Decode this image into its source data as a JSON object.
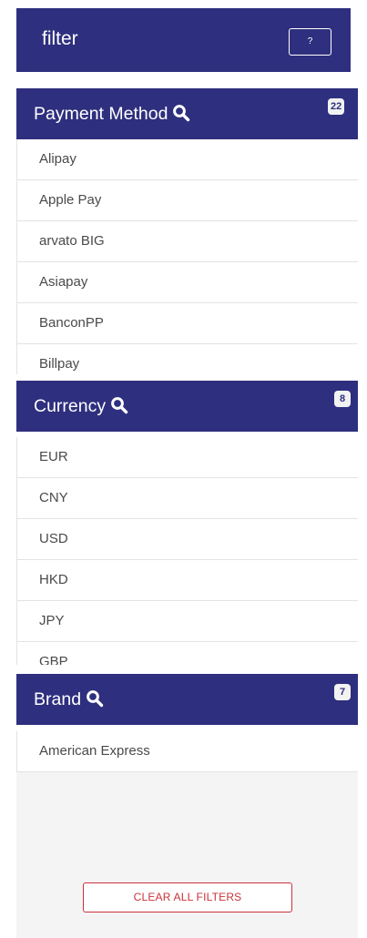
{
  "filter": {
    "title": "filter",
    "help_label": "?"
  },
  "sections": [
    {
      "title": "Payment Method",
      "count": "22",
      "options": [
        "Alipay",
        "Apple Pay",
        "arvato BIG",
        "Asiapay",
        "BanconPP",
        "Billpay"
      ]
    },
    {
      "title": "Currency",
      "count": "8",
      "options": [
        "EUR",
        "CNY",
        "USD",
        "HKD",
        "JPY",
        "GBP"
      ]
    },
    {
      "title": "Brand",
      "count": "7",
      "options": [
        "American Express"
      ]
    }
  ],
  "clear_all_label": "CLEAR ALL FILTERS",
  "icons": {
    "section_search": "search-icon"
  },
  "colors": {
    "header_bg": "#2f2f7f",
    "header_text": "#ffffff",
    "badge_bg": "#f2f2f2",
    "clear_button": "#c9333a",
    "bottom_bg": "#f4f4f5"
  }
}
